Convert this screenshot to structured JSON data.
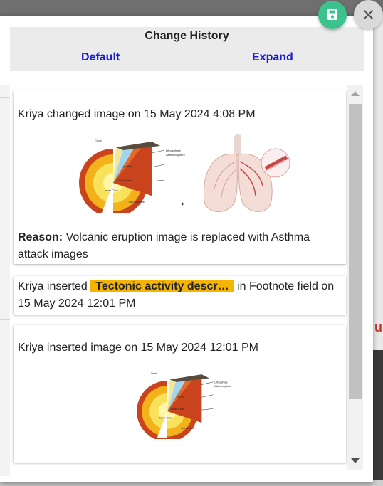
{
  "header": {
    "title": "Change History",
    "default_label": "Default",
    "expand_label": "Expand"
  },
  "entries": [
    {
      "text": "Kriya changed image on 15 May 2024 4:08 PM",
      "reason_label": "Reason:",
      "reason_text": " Volcanic eruption image is replaced with Asthma attack images",
      "arrow": "→"
    },
    {
      "prefix": "Kriya inserted ",
      "highlight": "Tectonic activity descr…",
      "suffix": " in Footnote field on 15 May 2024 12:01 PM"
    },
    {
      "text": "Kriya inserted image on 15 May 2024 12:01 PM"
    }
  ],
  "earth_diagram_labels": [
    "Crust",
    "Lithosphere",
    "Asthenosphere",
    "Mantle",
    "Outer Core",
    "Inner Core",
    "Not to Scale"
  ],
  "colors": {
    "save": "#3cc28c",
    "highlight": "#f5b400",
    "link": "#1a1ad6"
  },
  "icons": {
    "save": "save-icon",
    "close": "close-icon"
  }
}
